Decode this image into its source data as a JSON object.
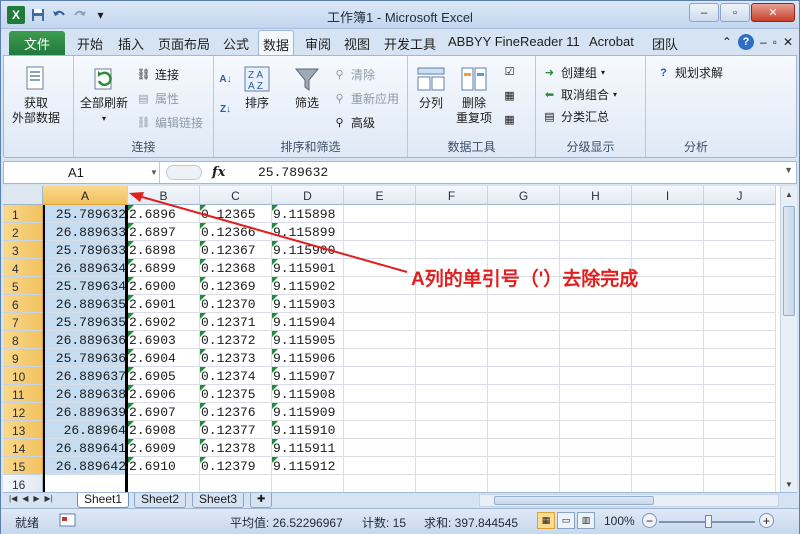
{
  "window": {
    "title": "工作簿1 - Microsoft Excel",
    "controls": [
      "–",
      "▫",
      "✕"
    ]
  },
  "quick_access": {
    "logo": "X",
    "icons": [
      "save-icon",
      "undo-icon",
      "redo-icon",
      "customize-icon"
    ]
  },
  "tabs": {
    "file": "文件",
    "items": [
      "开始",
      "插入",
      "页面布局",
      "公式",
      "数据",
      "审阅",
      "视图",
      "开发工具",
      "ABBYY FineReader 11",
      "Acrobat",
      "团队"
    ],
    "active": "数据"
  },
  "ribbon": {
    "get_external": {
      "line1": "获取",
      "line2": "外部数据"
    },
    "connections": {
      "refresh_all": "全部刷新",
      "connect": "连接",
      "properties": "属性",
      "edit_links": "编辑链接",
      "label": "连接"
    },
    "sort_filter": {
      "sort": "排序",
      "filter": "筛选",
      "clear": "清除",
      "reapply": "重新应用",
      "advanced": "高级",
      "label": "排序和筛选"
    },
    "data_tools": {
      "split": "分列",
      "remove_dup_1": "删除",
      "remove_dup_2": "重复项",
      "label": "数据工具"
    },
    "outline": {
      "group": "创建组",
      "ungroup": "取消组合",
      "subtotal": "分类汇总",
      "label": "分级显示"
    },
    "analysis": {
      "solver": "规划求解",
      "label": "分析"
    }
  },
  "formula_bar": {
    "name_box": "A1",
    "fx": "fx",
    "value": "25.789632"
  },
  "grid": {
    "columns": [
      "A",
      "B",
      "C",
      "D",
      "E",
      "F",
      "G",
      "H",
      "I",
      "J"
    ],
    "rows": [
      [
        "25.789632",
        "2.6896",
        "0.12365",
        "9.115898"
      ],
      [
        "26.889633",
        "2.6897",
        "0.12366",
        "9.115899"
      ],
      [
        "25.789633",
        "2.6898",
        "0.12367",
        "9.115900"
      ],
      [
        "26.889634",
        "2.6899",
        "0.12368",
        "9.115901"
      ],
      [
        "25.789634",
        "2.6900",
        "0.12369",
        "9.115902"
      ],
      [
        "26.889635",
        "2.6901",
        "0.12370",
        "9.115903"
      ],
      [
        "25.789635",
        "2.6902",
        "0.12371",
        "9.115904"
      ],
      [
        "26.889636",
        "2.6903",
        "0.12372",
        "9.115905"
      ],
      [
        "25.789636",
        "2.6904",
        "0.12373",
        "9.115906"
      ],
      [
        "26.889637",
        "2.6905",
        "0.12374",
        "9.115907"
      ],
      [
        "26.889638",
        "2.6906",
        "0.12375",
        "9.115908"
      ],
      [
        "26.889639",
        "2.6907",
        "0.12376",
        "9.115909"
      ],
      [
        "26.88964",
        "2.6908",
        "0.12377",
        "9.115910"
      ],
      [
        "26.889641",
        "2.6909",
        "0.12378",
        "9.115911"
      ],
      [
        "26.889642",
        "2.6910",
        "0.12379",
        "9.115912"
      ],
      [
        "",
        "",
        "",
        ""
      ]
    ],
    "row_numbers": [
      "1",
      "2",
      "3",
      "4",
      "5",
      "6",
      "7",
      "8",
      "9",
      "10",
      "11",
      "12",
      "13",
      "14",
      "15",
      "16"
    ]
  },
  "annotation": {
    "text": "A列的单引号（'）去除完成",
    "color": "#e21f1f"
  },
  "sheet_tabs": [
    "Sheet1",
    "Sheet2",
    "Sheet3"
  ],
  "status_bar": {
    "ready": "就绪",
    "average": "平均值: 26.52296967",
    "count": "计数: 15",
    "sum": "求和: 397.844545",
    "zoom": "100%"
  },
  "colors": {
    "file_tab": "#1f7a3c",
    "selected_column": "#c5dcf1",
    "header_highlight": "#f1c15f",
    "error_triangle": "#1e8c3a"
  }
}
